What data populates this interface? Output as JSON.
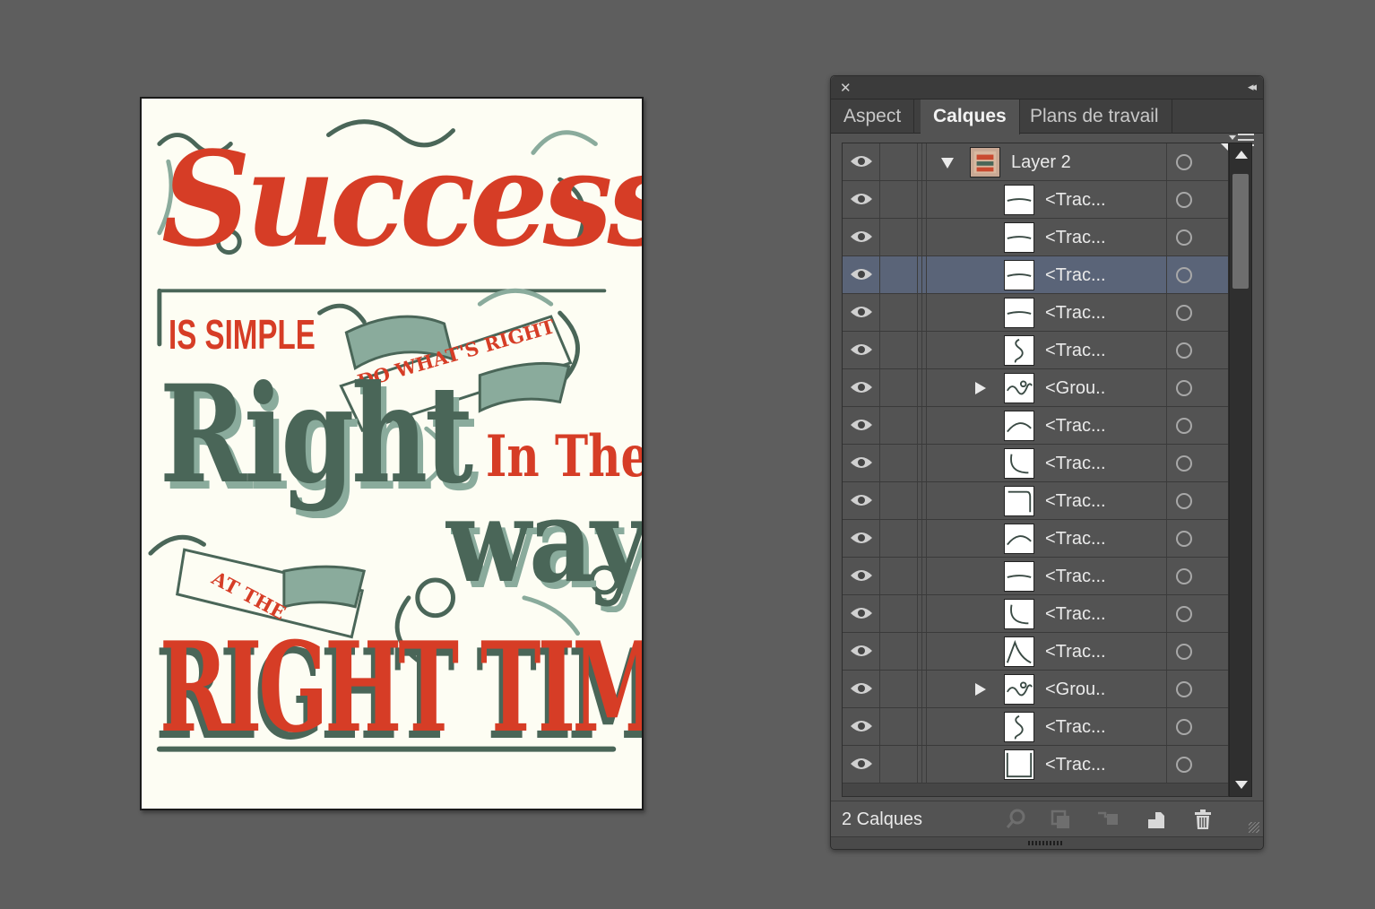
{
  "artwork": {
    "line1": "Success",
    "line2": "IS SIMPLE",
    "banner1": "DO WHAT'S RIGHT",
    "line3": "Right",
    "line4": "In The",
    "line5": "way",
    "banner2": "AT THE",
    "line6": "RIGHT TIME",
    "colors": {
      "paper": "#fdfdf3",
      "red": "#d63d26",
      "green": "#4a6658",
      "light_green": "#8aab9c"
    }
  },
  "panel": {
    "tabs": [
      {
        "label": "Aspect",
        "active": false
      },
      {
        "label": "Calques",
        "active": true
      },
      {
        "label": "Plans de travail",
        "active": false
      }
    ],
    "layer": {
      "name": "Layer 2"
    },
    "rows": [
      {
        "label": "<Trac...",
        "thumb": "line-icon",
        "group": false,
        "selected": false
      },
      {
        "label": "<Trac...",
        "thumb": "line-icon",
        "group": false,
        "selected": false
      },
      {
        "label": "<Trac...",
        "thumb": "line-icon",
        "group": false,
        "selected": true
      },
      {
        "label": "<Trac...",
        "thumb": "line-icon",
        "group": false,
        "selected": false
      },
      {
        "label": "<Trac...",
        "thumb": "swirl-icon",
        "group": false,
        "selected": false
      },
      {
        "label": "<Grou..",
        "thumb": "ornament-icon",
        "group": true,
        "selected": false
      },
      {
        "label": "<Trac...",
        "thumb": "curve-icon",
        "group": false,
        "selected": false
      },
      {
        "label": "<Trac...",
        "thumb": "arc-icon",
        "group": false,
        "selected": false
      },
      {
        "label": "<Trac...",
        "thumb": "hook-icon",
        "group": false,
        "selected": false
      },
      {
        "label": "<Trac...",
        "thumb": "curve-icon",
        "group": false,
        "selected": false
      },
      {
        "label": "<Trac...",
        "thumb": "line-icon",
        "group": false,
        "selected": false
      },
      {
        "label": "<Trac...",
        "thumb": "arc-icon",
        "group": false,
        "selected": false
      },
      {
        "label": "<Trac...",
        "thumb": "peak-icon",
        "group": false,
        "selected": false
      },
      {
        "label": "<Grou..",
        "thumb": "ornament-icon",
        "group": true,
        "selected": false
      },
      {
        "label": "<Trac...",
        "thumb": "swirl-icon",
        "group": false,
        "selected": false
      },
      {
        "label": "<Trac...",
        "thumb": "frame-icon",
        "group": false,
        "selected": false
      }
    ],
    "footer": {
      "count": "2 Calques"
    },
    "selection_color": "#5a6478"
  }
}
